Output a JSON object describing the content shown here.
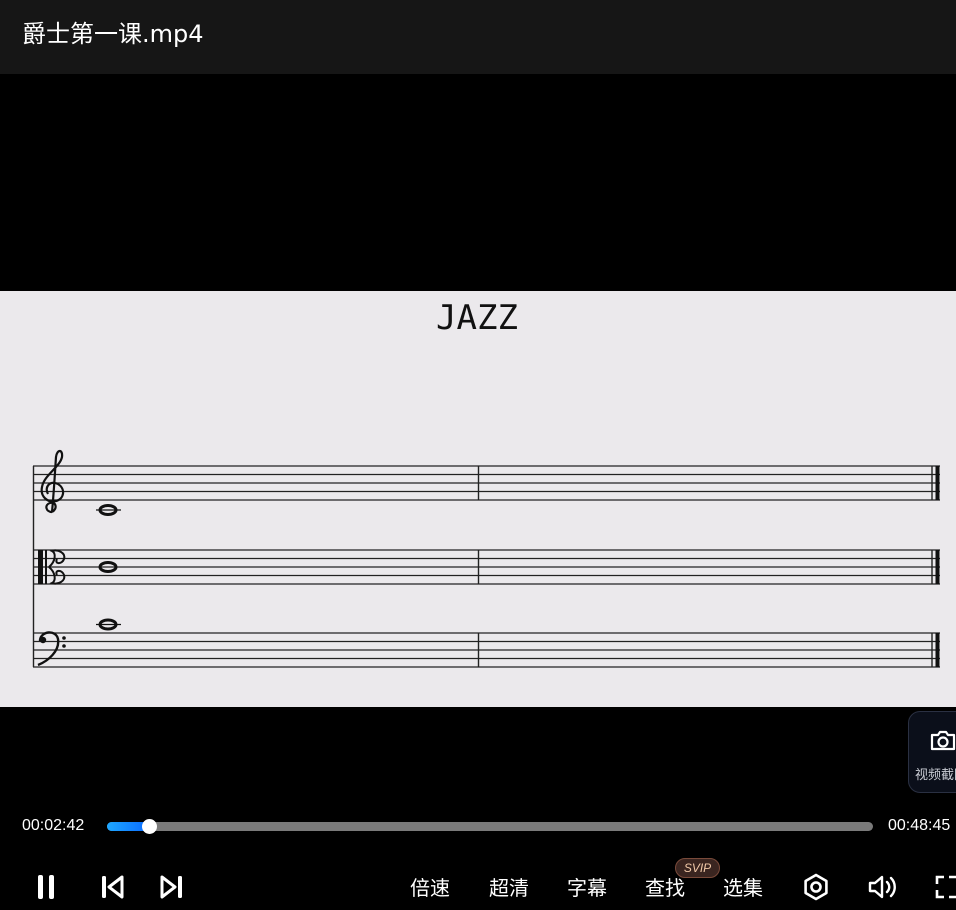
{
  "window": {
    "title": "爵士第一课.mp4"
  },
  "video": {
    "frame_title": "JAZZ",
    "screenshot_button": {
      "label": "视频截图",
      "icon": "camera-icon"
    }
  },
  "playback": {
    "current_time": "00:02:42",
    "total_time": "00:48:45",
    "progress_fraction": 0.0554
  },
  "controls": {
    "left": [
      {
        "name": "pause-button",
        "icon": "pause-icon"
      },
      {
        "name": "previous-button",
        "icon": "skip-previous-icon"
      },
      {
        "name": "next-button",
        "icon": "skip-next-icon"
      }
    ],
    "speed_label": "倍速",
    "quality_label": "超清",
    "subtitle_label": "字幕",
    "search_label": "查找",
    "search_badge": "SVIP",
    "episodes_label": "选集",
    "right_icons": [
      "settings-icon",
      "volume-icon",
      "fullscreen-icon"
    ]
  },
  "colors": {
    "titlebar_bg": "#161616",
    "progress_fill": "#1ea7ff",
    "progress_track": "#7a7a7a",
    "sheet_bg": "#ebe9ec",
    "badge_text": "#f1c9a8"
  }
}
